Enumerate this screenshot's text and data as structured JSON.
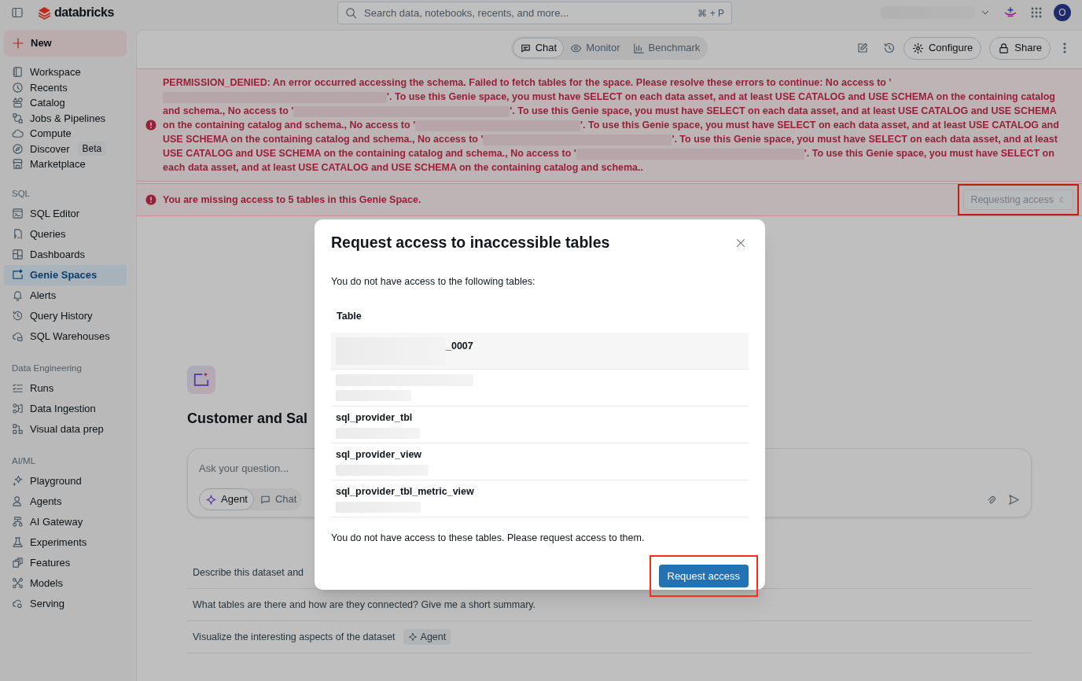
{
  "top_bar": {
    "brand": "databricks",
    "search": {
      "placeholder": "Search data, notebooks, recents, and more...",
      "shortcut": "⌘ + P"
    },
    "avatar": "O"
  },
  "sidebar": {
    "new_button": "New",
    "sections": [
      {
        "items": [
          {
            "label": "Workspace",
            "selected": false
          },
          {
            "label": "Recents",
            "selected": false
          },
          {
            "label": "Catalog",
            "selected": false
          },
          {
            "label": "Jobs & Pipelines",
            "selected": false
          },
          {
            "label": "Compute",
            "selected": false
          },
          {
            "label": "Discover",
            "badge": "Beta",
            "selected": false
          },
          {
            "label": "Marketplace",
            "selected": false
          }
        ]
      },
      {
        "title": "SQL",
        "items": [
          {
            "label": "SQL Editor",
            "selected": false
          },
          {
            "label": "Queries",
            "selected": false
          },
          {
            "label": "Dashboards",
            "selected": false
          },
          {
            "label": "Genie Spaces",
            "selected": true
          },
          {
            "label": "Alerts",
            "selected": false
          },
          {
            "label": "Query History",
            "selected": false
          },
          {
            "label": "SQL Warehouses",
            "selected": false
          }
        ]
      },
      {
        "title": "Data Engineering",
        "items": [
          {
            "label": "Runs",
            "selected": false
          },
          {
            "label": "Data Ingestion",
            "selected": false
          },
          {
            "label": "Visual data prep",
            "selected": false
          }
        ]
      },
      {
        "title": "AI/ML",
        "items": [
          {
            "label": "Playground",
            "selected": false
          },
          {
            "label": "Agents",
            "selected": false
          },
          {
            "label": "AI Gateway",
            "selected": false
          },
          {
            "label": "Experiments",
            "selected": false
          },
          {
            "label": "Features",
            "selected": false
          },
          {
            "label": "Models",
            "selected": false
          },
          {
            "label": "Serving",
            "selected": false
          }
        ]
      }
    ]
  },
  "header": {
    "tabs": [
      {
        "label": "Chat",
        "selected": true
      },
      {
        "label": "Monitor",
        "selected": false
      },
      {
        "label": "Benchmark",
        "selected": false
      }
    ],
    "actions": [
      "Configure",
      "Share"
    ]
  },
  "error_banner": {
    "segments": [
      "PERMISSION_DENIED: An error occurred accessing the schema. Failed to fetch tables for the space. Please resolve these errors to continue: No access to '",
      "'. To use this Genie space, you must have SELECT on each data asset, and at least USE CATALOG and USE SCHEMA on the containing catalog and schema., No access to '",
      "'. To use this Genie space, you must have SELECT on each data asset, and at least USE CATALOG and USE SCHEMA on the containing catalog and schema., No access to '",
      "'. To use this Genie space, you must have SELECT on each data asset, and at least USE CATALOG and USE SCHEMA on the containing catalog and schema., No access to '",
      "'. To use this Genie space, you must have SELECT on each data asset, and at least USE CATALOG and USE SCHEMA on the containing catalog and schema., No access to '",
      "'. To use this Genie space, you must have SELECT on each data asset, and at least USE CATALOG and USE SCHEMA on the containing catalog and schema.."
    ]
  },
  "access_banner": {
    "message": "You are missing access to 5 tables in this Genie Space.",
    "button": {
      "label": "Requesting access",
      "disabled": true,
      "annotated": true
    }
  },
  "space": {
    "title": "Customer and Sal",
    "question": {
      "placeholder": "Ask your question...",
      "modes": [
        {
          "label": "Agent",
          "selected": true
        },
        {
          "label": "Chat",
          "selected": false
        }
      ]
    },
    "suggestions": [
      {
        "text": "Describe this dataset and"
      },
      {
        "text": "What tables are there and how are they connected? Give me a short summary."
      },
      {
        "text": "Visualize the interesting aspects of the dataset",
        "badge": "Agent"
      }
    ]
  },
  "modal": {
    "title": "Request access to inaccessible tables",
    "intro": "You do not have access to the following tables:",
    "table": {
      "columns": [
        "Table"
      ],
      "rows": [
        {
          "name": "_0007",
          "name_redacted": true,
          "hovered": true
        },
        {
          "name_redacted": true,
          "hovered": false
        },
        {
          "name": "sql_provider_tbl",
          "name_redacted": false,
          "hovered": false
        },
        {
          "name": "sql_provider_view",
          "name_redacted": false,
          "hovered": false
        },
        {
          "name": "sql_provider_tbl_metric_view",
          "name_redacted": false,
          "hovered": false
        }
      ]
    },
    "footer_text": "You do not have access to these tables. Please request access to them.",
    "button": {
      "label": "Request access",
      "annotated": true
    }
  }
}
